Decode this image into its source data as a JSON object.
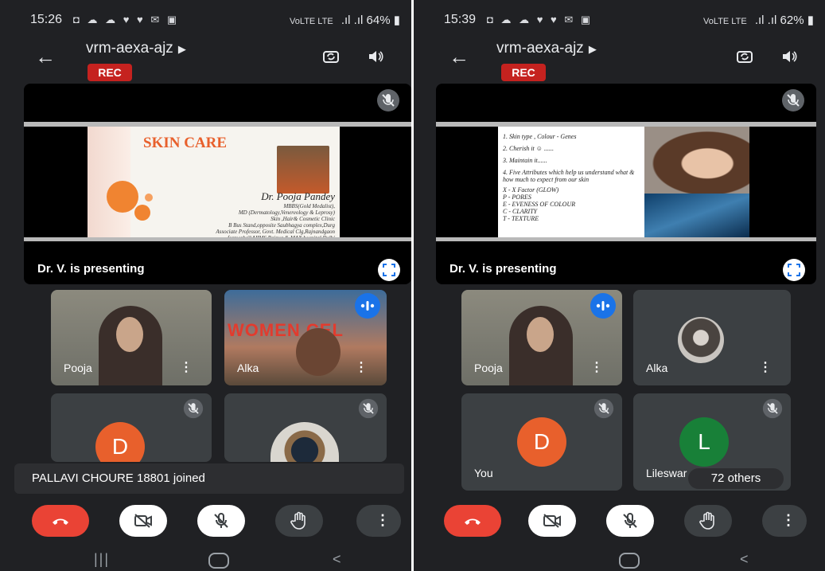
{
  "colors": {
    "bg": "#202124",
    "tile": "#3c4043",
    "rec": "#c5221f",
    "end_call": "#ea4335",
    "accent_blue": "#1a73e8",
    "avatar_orange": "#e8602c",
    "avatar_green": "#188038"
  },
  "left": {
    "status": {
      "time": "15:26",
      "icons": "◘ ☁ ☁ ♥ ♥ ✉ ▣",
      "network": "VoLTE LTE",
      "signal": ".ıl .ıl",
      "battery": "64%"
    },
    "meeting_code": "vrm-aexa-ajz",
    "rec": "REC",
    "slide": {
      "title": "SKIN CARE",
      "presenter_name": "Dr. Pooja Pandey",
      "lines": [
        "MBBS(Gold Medalist),",
        "MD (Dermatology,Venereology & Leprosy)",
        "Skin ,Hair& Cosmetic Clinic",
        "B Bus Stand,opposite Saubhagya complex,Durg",
        "Associate Professor, Govt. Medical Clg,Rajnandgaon",
        "formerly@AIIMS,Raipur & MAX hospital,Delhi"
      ]
    },
    "presenting": "Dr. V. is presenting",
    "tiles": [
      {
        "name": "Pooja"
      },
      {
        "name": "Alka",
        "banner": "WOMEN CEL"
      },
      {
        "letter": "D"
      },
      {}
    ],
    "toast": "PALLAVI CHOURE 18801 joined"
  },
  "right": {
    "status": {
      "time": "15:39",
      "icons": "◘ ☁ ☁ ♥ ♥ ✉ ▣",
      "network": "VoLTE LTE",
      "signal": ".ıl .ıl",
      "battery": "62%"
    },
    "meeting_code": "vrm-aexa-ajz",
    "rec": "REC",
    "slide": {
      "lines": [
        "1. Skin type , Colour - Genes",
        "2. Cherish it ☺ ......",
        "3. Maintain it......",
        "4. Five Attributes which help us understand what & how much to expect from our skin",
        "X - X Factor (GLOW)",
        "P - PORES",
        "E - EVENESS OF COLOUR",
        "C - CLARITY",
        "T - TEXTURE"
      ]
    },
    "presenting": "Dr. V. is presenting",
    "tiles": [
      {
        "name": "Pooja"
      },
      {
        "name": "Alka"
      },
      {
        "letter": "D",
        "name": "You"
      },
      {
        "letter": "L",
        "name": "Lileswar"
      }
    ],
    "others": "72 others"
  }
}
